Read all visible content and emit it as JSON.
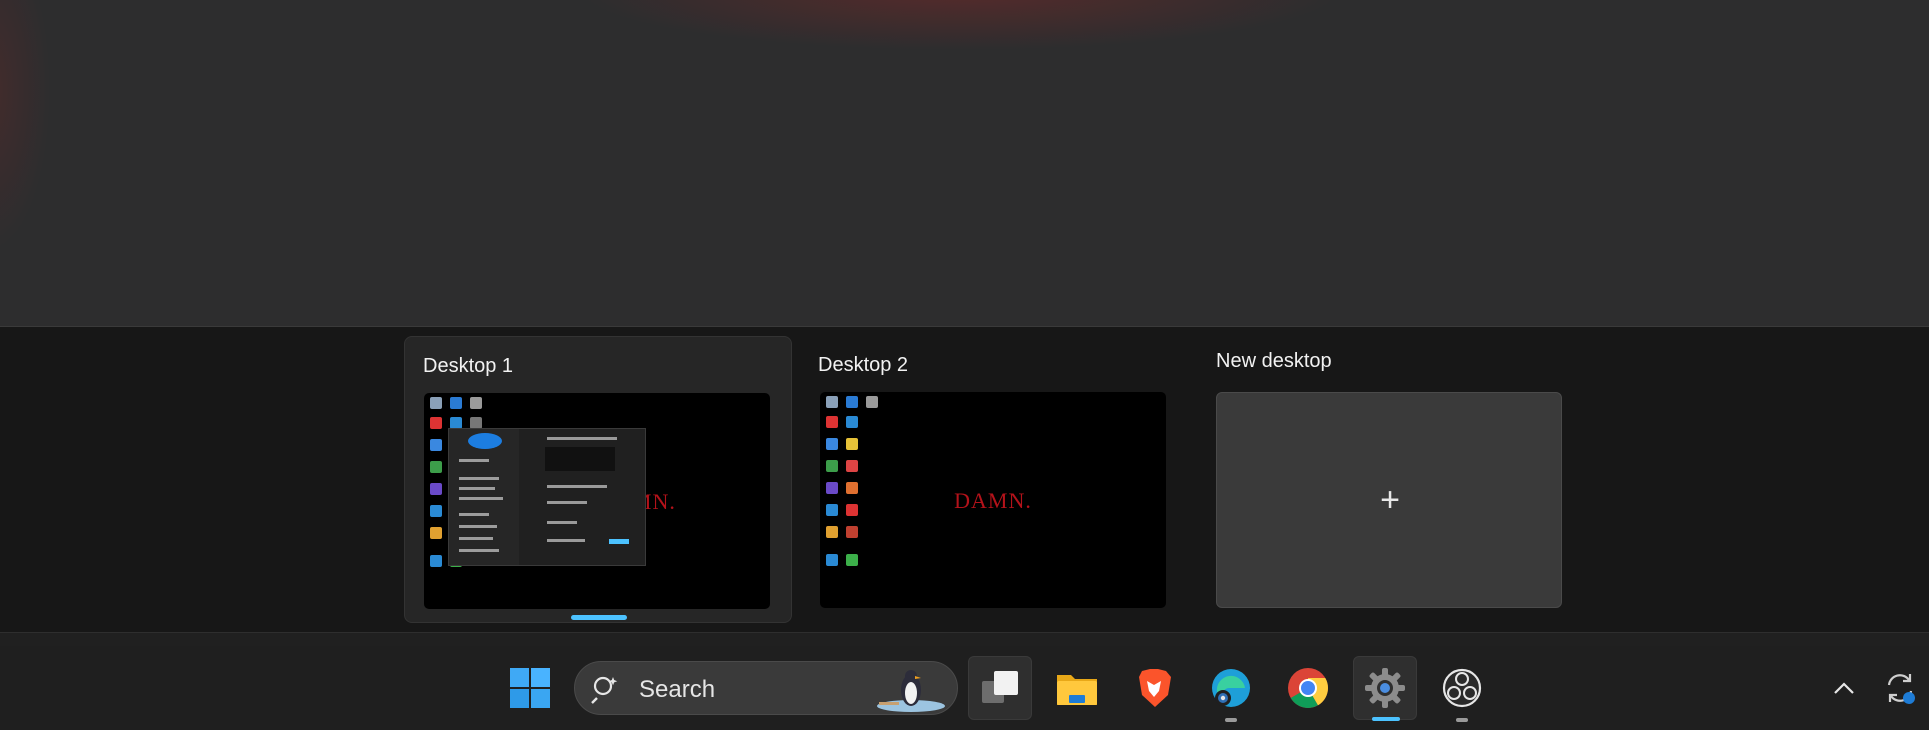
{
  "desktops": [
    {
      "title": "Desktop 1",
      "wallpaper_text": "DAMN.",
      "active": true
    },
    {
      "title": "Desktop 2",
      "wallpaper_text": "DAMN.",
      "active": false
    }
  ],
  "new_desktop": {
    "title": "New desktop",
    "icon": "plus-icon"
  },
  "taskbar": {
    "search": {
      "label": "Search",
      "icon": "search-icon"
    },
    "apps": [
      {
        "name": "start",
        "icon": "windows-start-icon"
      },
      {
        "name": "task-view",
        "icon": "task-view-icon"
      },
      {
        "name": "file-explorer",
        "icon": "folder-icon"
      },
      {
        "name": "brave",
        "icon": "brave-browser-icon"
      },
      {
        "name": "edge",
        "icon": "edge-browser-icon"
      },
      {
        "name": "chrome",
        "icon": "chrome-browser-icon"
      },
      {
        "name": "settings",
        "icon": "settings-gear-icon"
      },
      {
        "name": "obs",
        "icon": "obs-studio-icon"
      }
    ],
    "tray": [
      {
        "name": "show-hidden",
        "icon": "chevron-up-icon"
      },
      {
        "name": "update",
        "icon": "sync-update-icon"
      }
    ]
  },
  "colors": {
    "accent": "#4cc2ff",
    "wallpaper_text": "#b3121a",
    "taskbar": "#1f1f1f"
  }
}
